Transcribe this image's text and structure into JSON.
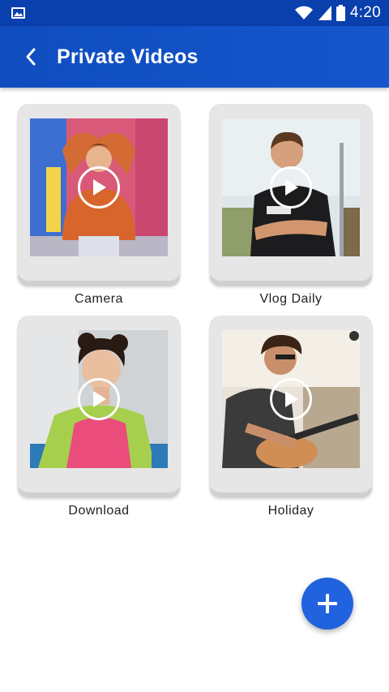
{
  "status_bar": {
    "time": "4:20",
    "icons": [
      "gallery-icon",
      "wifi-icon",
      "signal-icon",
      "battery-icon"
    ]
  },
  "app_bar": {
    "title": "Private Videos",
    "back_icon": "chevron-left-icon"
  },
  "folders": [
    {
      "label": "Camera",
      "icon": "play-icon"
    },
    {
      "label": "Vlog Daily",
      "icon": "play-icon"
    },
    {
      "label": "Download",
      "icon": "play-icon"
    },
    {
      "label": "Holiday",
      "icon": "play-icon"
    }
  ],
  "fab": {
    "icon": "plus-icon"
  },
  "colors": {
    "app_bar": "#1151c5",
    "status_bar": "#0a3fae",
    "fab": "#2162df",
    "card": "#e6e6e6"
  }
}
